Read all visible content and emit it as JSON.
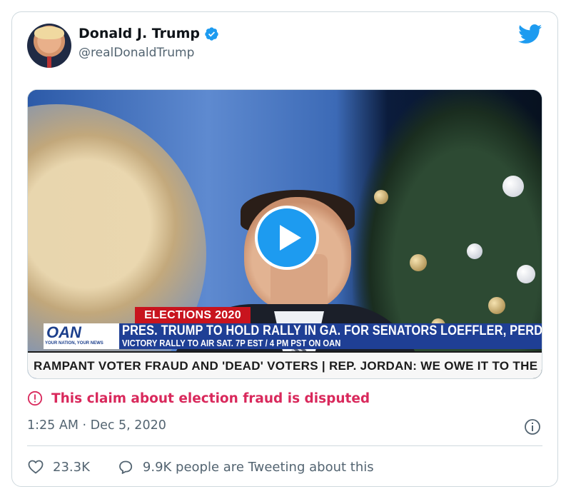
{
  "author": {
    "name": "Donald J. Trump",
    "handle": "@realDonaldTrump",
    "verified": true
  },
  "media": {
    "type": "video",
    "elections_tag": "ELECTIONS 2020",
    "network_logo": "OAN",
    "network_tagline": "YOUR NATION, YOUR NEWS",
    "headline": "PRES. TRUMP TO HOLD RALLY IN GA. FOR SENATORS LOEFFLER, PERDUE",
    "subline": "VICTORY RALLY TO AIR SAT. 7P EST / 4 PM PST ON OAN",
    "ticker": "RAMPANT VOTER FRAUD AND 'DEAD' VOTERS  |  REP. JORDAN: WE OWE IT TO THE CO"
  },
  "label": {
    "text": "This claim about election fraud is disputed",
    "color": "#d9295c"
  },
  "timestamp": "1:25 AM · Dec 5, 2020",
  "stats": {
    "likes": "23.3K",
    "conversation": "9.9K people are Tweeting about this"
  },
  "icons": {
    "brand": "twitter-bird-icon",
    "verified": "verified-badge-icon",
    "play": "play-icon",
    "alert": "alert-circle-icon",
    "info": "info-icon",
    "like": "heart-icon",
    "reply": "speech-bubble-icon"
  },
  "colors": {
    "twitter_blue": "#1d9bf0",
    "secondary_text": "#536471",
    "border": "#cfd9de"
  }
}
